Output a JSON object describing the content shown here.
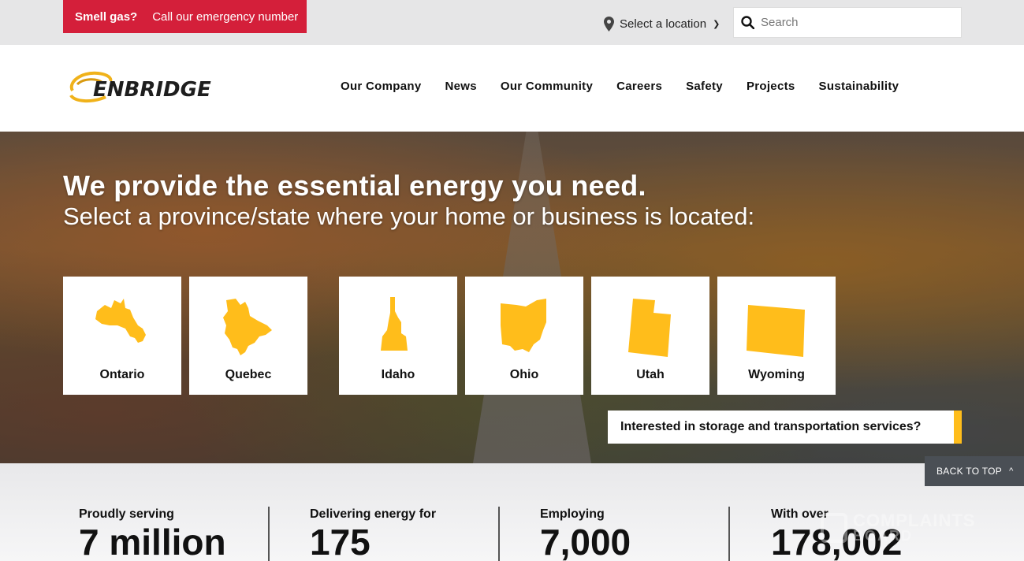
{
  "utility": {
    "gas_bold": "Smell gas?",
    "gas_text": "Call our emergency number",
    "location_label": "Select a location",
    "search_placeholder": "Search"
  },
  "brand": {
    "logo_text": "ENBRIDGE",
    "accent": "#ffbd1b",
    "alert_red": "#d41f3a"
  },
  "nav": {
    "items": [
      {
        "label": "Our Company"
      },
      {
        "label": "News"
      },
      {
        "label": "Our Community"
      },
      {
        "label": "Careers"
      },
      {
        "label": "Safety"
      },
      {
        "label": "Projects"
      },
      {
        "label": "Sustainability"
      }
    ]
  },
  "hero": {
    "title": "We provide the essential energy you need.",
    "subtitle": "Select a province/state where your home or business is located:",
    "regions": [
      {
        "label": "Ontario",
        "icon": "ontario-map-icon"
      },
      {
        "label": "Quebec",
        "icon": "quebec-map-icon"
      },
      {
        "label": "Idaho",
        "icon": "idaho-map-icon"
      },
      {
        "label": "Ohio",
        "icon": "ohio-map-icon"
      },
      {
        "label": "Utah",
        "icon": "utah-map-icon"
      },
      {
        "label": "Wyoming",
        "icon": "wyoming-map-icon"
      }
    ],
    "storage_cta": "Interested in storage and transportation services?"
  },
  "stats": [
    {
      "pre": "Proudly serving",
      "big": "7 million"
    },
    {
      "pre": "Delivering energy for",
      "big": "175"
    },
    {
      "pre": "Employing",
      "big": "7,000"
    },
    {
      "pre": "With over",
      "big": "178,002"
    }
  ],
  "back_to_top": "BACK TO TOP",
  "watermark": {
    "line1": "COMPLAINTS",
    "line2": "BOARD"
  }
}
